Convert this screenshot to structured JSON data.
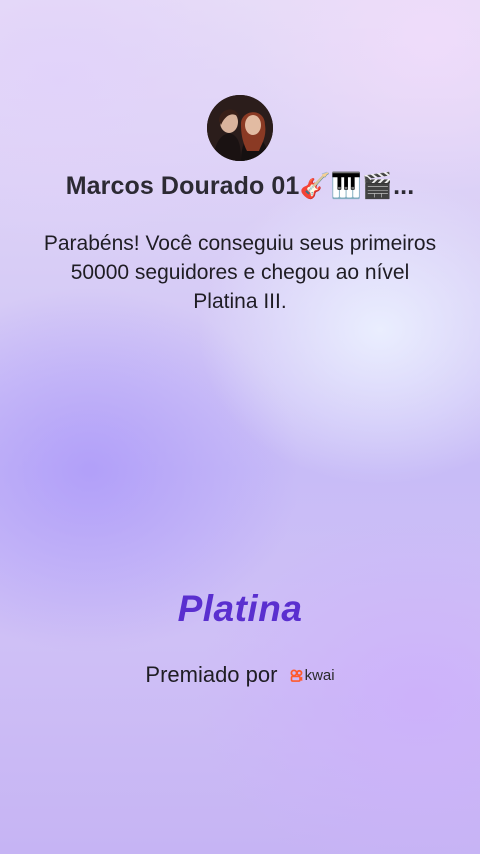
{
  "profile": {
    "name": "Marcos Dourado 01🎸🎹🎬..."
  },
  "message": "Parabéns! Você conseguiu seus primeiros 50000 seguidores e chegou ao nível Platina III.",
  "level_badge": "Platina",
  "awarded": {
    "label": "Premiado por",
    "brand": "kwai",
    "brand_color": "#ff5a2c"
  },
  "colors": {
    "level_text": "#5a2fcf"
  }
}
